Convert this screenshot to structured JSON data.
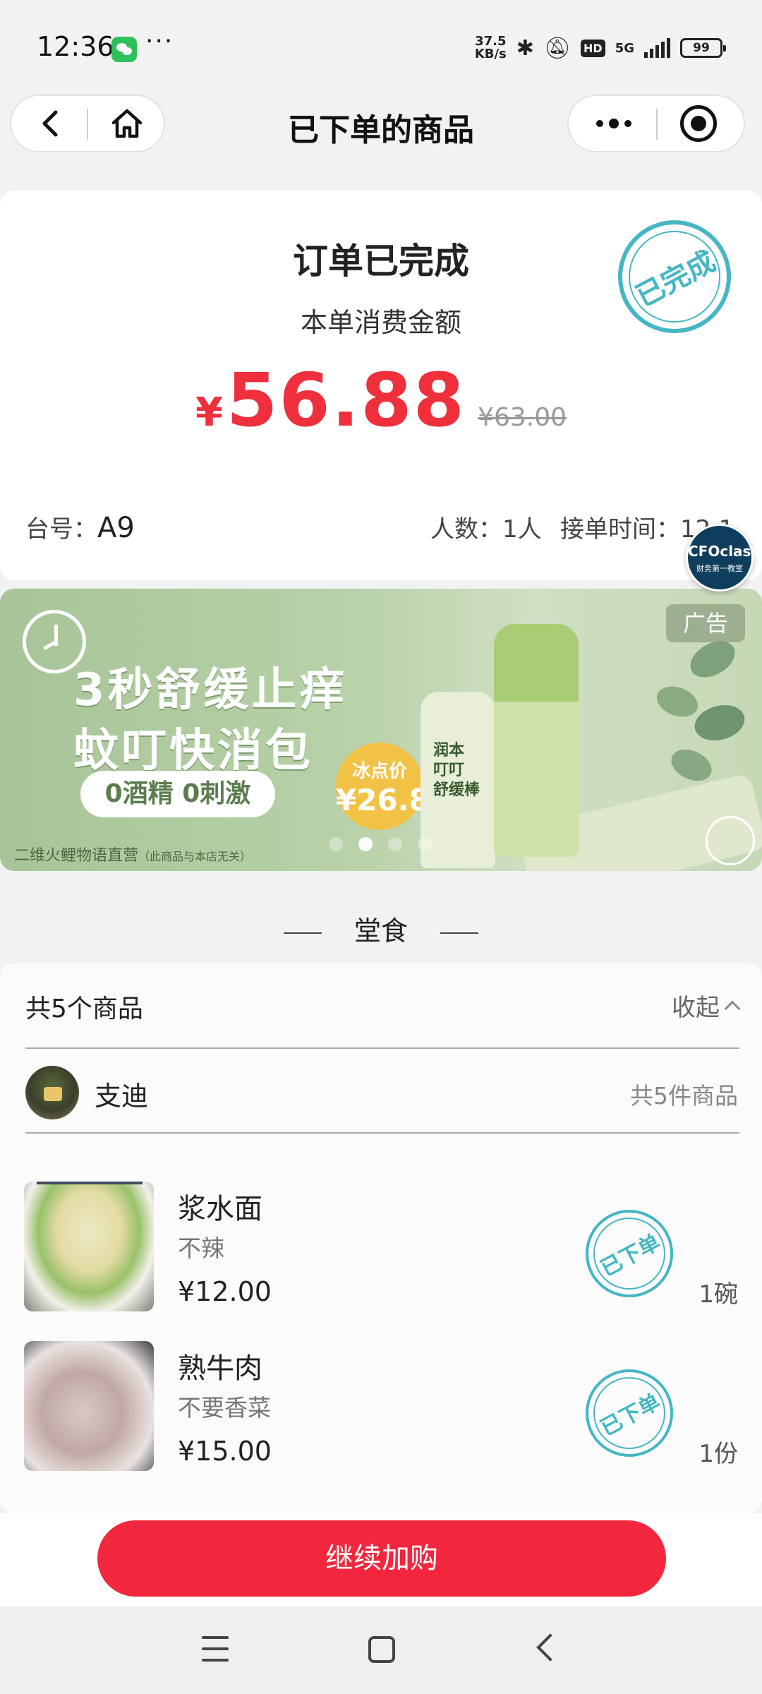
{
  "status_bar": {
    "time": "12:36",
    "more": "···",
    "speed_value": "37.5",
    "speed_unit": "KB/s",
    "hd": "HD",
    "network": "5G",
    "battery": "99",
    "icons": [
      "wechat-icon",
      "bluetooth-icon",
      "bell-off-icon",
      "hd-icon",
      "signal-icon",
      "battery-icon"
    ]
  },
  "nav": {
    "title": "已下单的商品",
    "icons": [
      "back-arrow-icon",
      "home-icon",
      "more-dots-icon",
      "close-target-icon"
    ]
  },
  "order": {
    "status": "订单已完成",
    "amount_label": "本单消费金额",
    "currency": "¥",
    "amount": "56.88",
    "original_price": "¥63.00",
    "stamp": "已完成",
    "table_label": "台号：",
    "table_value": "A9",
    "people": "人数：1人",
    "accept_time": "接单时间：12:1"
  },
  "floating_badge": {
    "title": "CFOclass",
    "subtitle": "财务第一教室"
  },
  "ad": {
    "headline1": "3秒舒缓止痒",
    "headline2": "蚊叮快消包",
    "pill": "0酒精 0刺激",
    "price_label": "冰点价",
    "price": "¥26.8",
    "product_text": "润本\n叮叮\n舒缓棒",
    "tag": "广告",
    "source": "二维火鲤物语直营",
    "disclaimer": "（此商品与本店无关）",
    "dots": 4,
    "active_dot": 1
  },
  "section": {
    "title": "堂食"
  },
  "goods": {
    "total": "共5个商品",
    "collapse": "收起",
    "shop_name": "支迪",
    "shop_count": "共5件商品",
    "items": [
      {
        "name": "浆水面",
        "note": "不辣",
        "price": "¥12.00",
        "qty": "1碗",
        "stamp": "已下单"
      },
      {
        "name": "熟牛肉",
        "note": "不要香菜",
        "price": "¥15.00",
        "qty": "1份",
        "stamp": "已下单"
      }
    ]
  },
  "actions": {
    "continue": "继续加购"
  },
  "colors": {
    "accent_red": "#ef2f3c",
    "button_red": "#f2263d",
    "stamp_teal": "#45b6c4",
    "ad_green": "#a7c497"
  }
}
